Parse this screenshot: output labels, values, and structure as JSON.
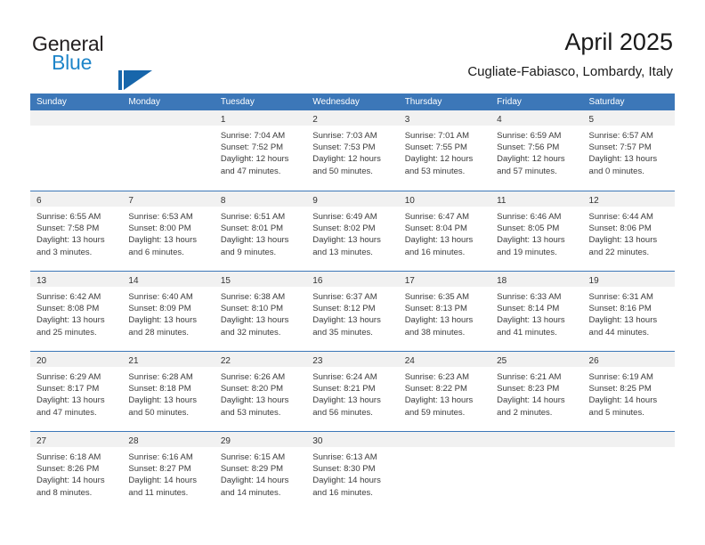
{
  "brand": {
    "name_part1": "General",
    "name_part2": "Blue",
    "mark_icon": "triangle-logo-icon",
    "color_dark": "#231f20",
    "color_blue": "#1e85c9",
    "color_mark": "#1766ab"
  },
  "header": {
    "title": "April 2025",
    "location": "Cugliate-Fabiasco, Lombardy, Italy"
  },
  "theme": {
    "header_blue": "#3c77b8",
    "day_band_gray": "#f1f1f1",
    "text_color": "#333333"
  },
  "weekdays": [
    "Sunday",
    "Monday",
    "Tuesday",
    "Wednesday",
    "Thursday",
    "Friday",
    "Saturday"
  ],
  "weeks": [
    [
      {
        "day": "",
        "sunrise": "",
        "sunset": "",
        "daylight_line1": "",
        "daylight_line2": ""
      },
      {
        "day": "",
        "sunrise": "",
        "sunset": "",
        "daylight_line1": "",
        "daylight_line2": ""
      },
      {
        "day": "1",
        "sunrise": "Sunrise: 7:04 AM",
        "sunset": "Sunset: 7:52 PM",
        "daylight_line1": "Daylight: 12 hours",
        "daylight_line2": "and 47 minutes."
      },
      {
        "day": "2",
        "sunrise": "Sunrise: 7:03 AM",
        "sunset": "Sunset: 7:53 PM",
        "daylight_line1": "Daylight: 12 hours",
        "daylight_line2": "and 50 minutes."
      },
      {
        "day": "3",
        "sunrise": "Sunrise: 7:01 AM",
        "sunset": "Sunset: 7:55 PM",
        "daylight_line1": "Daylight: 12 hours",
        "daylight_line2": "and 53 minutes."
      },
      {
        "day": "4",
        "sunrise": "Sunrise: 6:59 AM",
        "sunset": "Sunset: 7:56 PM",
        "daylight_line1": "Daylight: 12 hours",
        "daylight_line2": "and 57 minutes."
      },
      {
        "day": "5",
        "sunrise": "Sunrise: 6:57 AM",
        "sunset": "Sunset: 7:57 PM",
        "daylight_line1": "Daylight: 13 hours",
        "daylight_line2": "and 0 minutes."
      }
    ],
    [
      {
        "day": "6",
        "sunrise": "Sunrise: 6:55 AM",
        "sunset": "Sunset: 7:58 PM",
        "daylight_line1": "Daylight: 13 hours",
        "daylight_line2": "and 3 minutes."
      },
      {
        "day": "7",
        "sunrise": "Sunrise: 6:53 AM",
        "sunset": "Sunset: 8:00 PM",
        "daylight_line1": "Daylight: 13 hours",
        "daylight_line2": "and 6 minutes."
      },
      {
        "day": "8",
        "sunrise": "Sunrise: 6:51 AM",
        "sunset": "Sunset: 8:01 PM",
        "daylight_line1": "Daylight: 13 hours",
        "daylight_line2": "and 9 minutes."
      },
      {
        "day": "9",
        "sunrise": "Sunrise: 6:49 AM",
        "sunset": "Sunset: 8:02 PM",
        "daylight_line1": "Daylight: 13 hours",
        "daylight_line2": "and 13 minutes."
      },
      {
        "day": "10",
        "sunrise": "Sunrise: 6:47 AM",
        "sunset": "Sunset: 8:04 PM",
        "daylight_line1": "Daylight: 13 hours",
        "daylight_line2": "and 16 minutes."
      },
      {
        "day": "11",
        "sunrise": "Sunrise: 6:46 AM",
        "sunset": "Sunset: 8:05 PM",
        "daylight_line1": "Daylight: 13 hours",
        "daylight_line2": "and 19 minutes."
      },
      {
        "day": "12",
        "sunrise": "Sunrise: 6:44 AM",
        "sunset": "Sunset: 8:06 PM",
        "daylight_line1": "Daylight: 13 hours",
        "daylight_line2": "and 22 minutes."
      }
    ],
    [
      {
        "day": "13",
        "sunrise": "Sunrise: 6:42 AM",
        "sunset": "Sunset: 8:08 PM",
        "daylight_line1": "Daylight: 13 hours",
        "daylight_line2": "and 25 minutes."
      },
      {
        "day": "14",
        "sunrise": "Sunrise: 6:40 AM",
        "sunset": "Sunset: 8:09 PM",
        "daylight_line1": "Daylight: 13 hours",
        "daylight_line2": "and 28 minutes."
      },
      {
        "day": "15",
        "sunrise": "Sunrise: 6:38 AM",
        "sunset": "Sunset: 8:10 PM",
        "daylight_line1": "Daylight: 13 hours",
        "daylight_line2": "and 32 minutes."
      },
      {
        "day": "16",
        "sunrise": "Sunrise: 6:37 AM",
        "sunset": "Sunset: 8:12 PM",
        "daylight_line1": "Daylight: 13 hours",
        "daylight_line2": "and 35 minutes."
      },
      {
        "day": "17",
        "sunrise": "Sunrise: 6:35 AM",
        "sunset": "Sunset: 8:13 PM",
        "daylight_line1": "Daylight: 13 hours",
        "daylight_line2": "and 38 minutes."
      },
      {
        "day": "18",
        "sunrise": "Sunrise: 6:33 AM",
        "sunset": "Sunset: 8:14 PM",
        "daylight_line1": "Daylight: 13 hours",
        "daylight_line2": "and 41 minutes."
      },
      {
        "day": "19",
        "sunrise": "Sunrise: 6:31 AM",
        "sunset": "Sunset: 8:16 PM",
        "daylight_line1": "Daylight: 13 hours",
        "daylight_line2": "and 44 minutes."
      }
    ],
    [
      {
        "day": "20",
        "sunrise": "Sunrise: 6:29 AM",
        "sunset": "Sunset: 8:17 PM",
        "daylight_line1": "Daylight: 13 hours",
        "daylight_line2": "and 47 minutes."
      },
      {
        "day": "21",
        "sunrise": "Sunrise: 6:28 AM",
        "sunset": "Sunset: 8:18 PM",
        "daylight_line1": "Daylight: 13 hours",
        "daylight_line2": "and 50 minutes."
      },
      {
        "day": "22",
        "sunrise": "Sunrise: 6:26 AM",
        "sunset": "Sunset: 8:20 PM",
        "daylight_line1": "Daylight: 13 hours",
        "daylight_line2": "and 53 minutes."
      },
      {
        "day": "23",
        "sunrise": "Sunrise: 6:24 AM",
        "sunset": "Sunset: 8:21 PM",
        "daylight_line1": "Daylight: 13 hours",
        "daylight_line2": "and 56 minutes."
      },
      {
        "day": "24",
        "sunrise": "Sunrise: 6:23 AM",
        "sunset": "Sunset: 8:22 PM",
        "daylight_line1": "Daylight: 13 hours",
        "daylight_line2": "and 59 minutes."
      },
      {
        "day": "25",
        "sunrise": "Sunrise: 6:21 AM",
        "sunset": "Sunset: 8:23 PM",
        "daylight_line1": "Daylight: 14 hours",
        "daylight_line2": "and 2 minutes."
      },
      {
        "day": "26",
        "sunrise": "Sunrise: 6:19 AM",
        "sunset": "Sunset: 8:25 PM",
        "daylight_line1": "Daylight: 14 hours",
        "daylight_line2": "and 5 minutes."
      }
    ],
    [
      {
        "day": "27",
        "sunrise": "Sunrise: 6:18 AM",
        "sunset": "Sunset: 8:26 PM",
        "daylight_line1": "Daylight: 14 hours",
        "daylight_line2": "and 8 minutes."
      },
      {
        "day": "28",
        "sunrise": "Sunrise: 6:16 AM",
        "sunset": "Sunset: 8:27 PM",
        "daylight_line1": "Daylight: 14 hours",
        "daylight_line2": "and 11 minutes."
      },
      {
        "day": "29",
        "sunrise": "Sunrise: 6:15 AM",
        "sunset": "Sunset: 8:29 PM",
        "daylight_line1": "Daylight: 14 hours",
        "daylight_line2": "and 14 minutes."
      },
      {
        "day": "30",
        "sunrise": "Sunrise: 6:13 AM",
        "sunset": "Sunset: 8:30 PM",
        "daylight_line1": "Daylight: 14 hours",
        "daylight_line2": "and 16 minutes."
      },
      {
        "day": "",
        "sunrise": "",
        "sunset": "",
        "daylight_line1": "",
        "daylight_line2": ""
      },
      {
        "day": "",
        "sunrise": "",
        "sunset": "",
        "daylight_line1": "",
        "daylight_line2": ""
      },
      {
        "day": "",
        "sunrise": "",
        "sunset": "",
        "daylight_line1": "",
        "daylight_line2": ""
      }
    ]
  ]
}
